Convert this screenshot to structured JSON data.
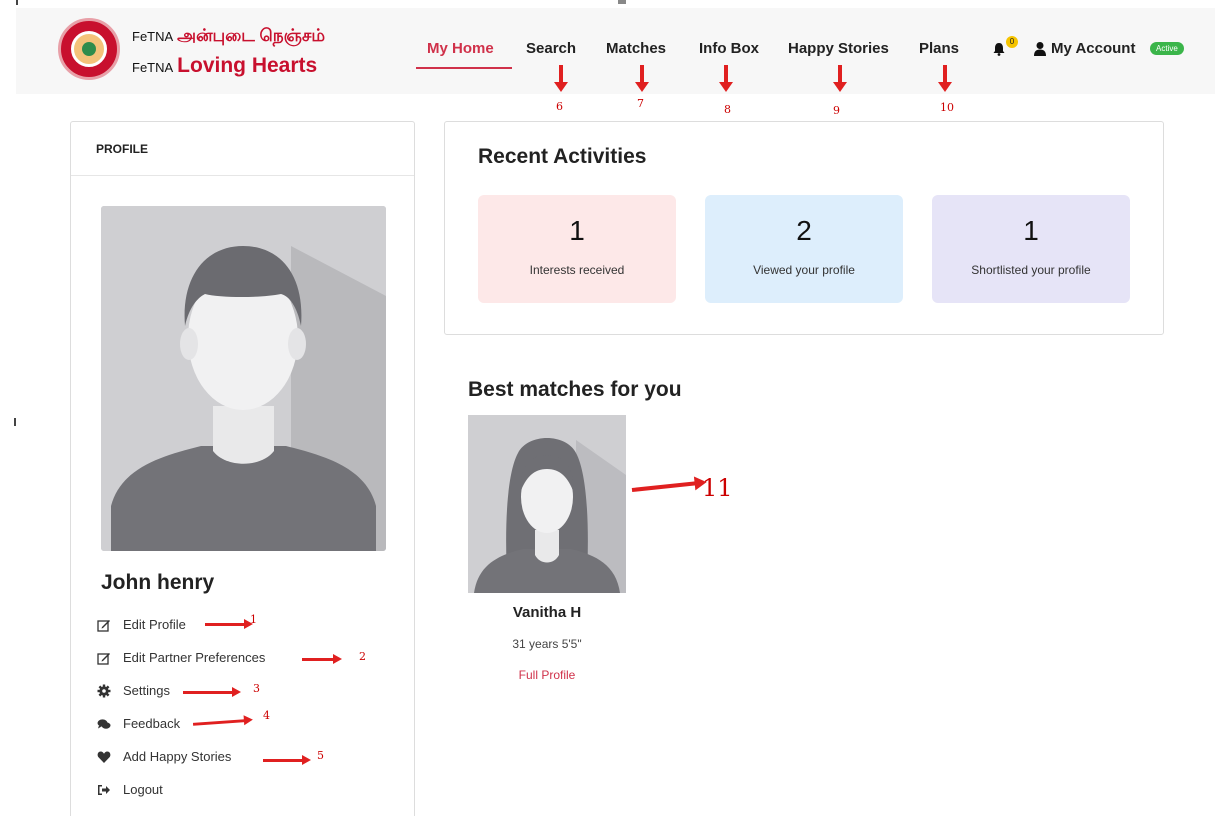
{
  "logo": {
    "prefix_1": "FeTNA",
    "tamil": "அன்புடை நெஞ்சம்",
    "prefix_2": "FeTNA",
    "english": "Loving Hearts"
  },
  "nav": {
    "items": [
      {
        "label": "My Home",
        "active": true
      },
      {
        "label": "Search"
      },
      {
        "label": "Matches"
      },
      {
        "label": "Info Box"
      },
      {
        "label": "Happy Stories"
      },
      {
        "label": "Plans"
      }
    ],
    "notification_count": "0",
    "account_label": "My Account",
    "account_status": "Active"
  },
  "annotations": {
    "nav": [
      "6",
      "7",
      "8",
      "9",
      "10"
    ],
    "menu": [
      "1",
      "2",
      "3",
      "4",
      "5"
    ],
    "match": "11"
  },
  "profile": {
    "header": "PROFILE",
    "name": "John henry",
    "menu": [
      {
        "label": "Edit Profile",
        "icon": "edit-icon"
      },
      {
        "label": "Edit Partner Preferences",
        "icon": "edit-icon"
      },
      {
        "label": "Settings",
        "icon": "gear-icon"
      },
      {
        "label": "Feedback",
        "icon": "comments-icon"
      },
      {
        "label": "Add Happy Stories",
        "icon": "heart-icon"
      },
      {
        "label": "Logout",
        "icon": "sign-out-icon"
      }
    ]
  },
  "activities": {
    "title": "Recent Activities",
    "stats": [
      {
        "value": "1",
        "label": "Interests received",
        "color": "#fde8e8"
      },
      {
        "value": "2",
        "label": "Viewed your profile",
        "color": "#ddeefc"
      },
      {
        "value": "1",
        "label": "Shortlisted your profile",
        "color": "#e6e4f7"
      }
    ]
  },
  "best_matches": {
    "title": "Best matches for you",
    "items": [
      {
        "name": "Vanitha H",
        "meta": "31 years 5'5\"",
        "link": "Full Profile"
      }
    ]
  },
  "colors": {
    "brand": "#c8102e",
    "nav_active": "#d0314a",
    "annotation": "#e02020",
    "status_active": "#3bb54a"
  }
}
